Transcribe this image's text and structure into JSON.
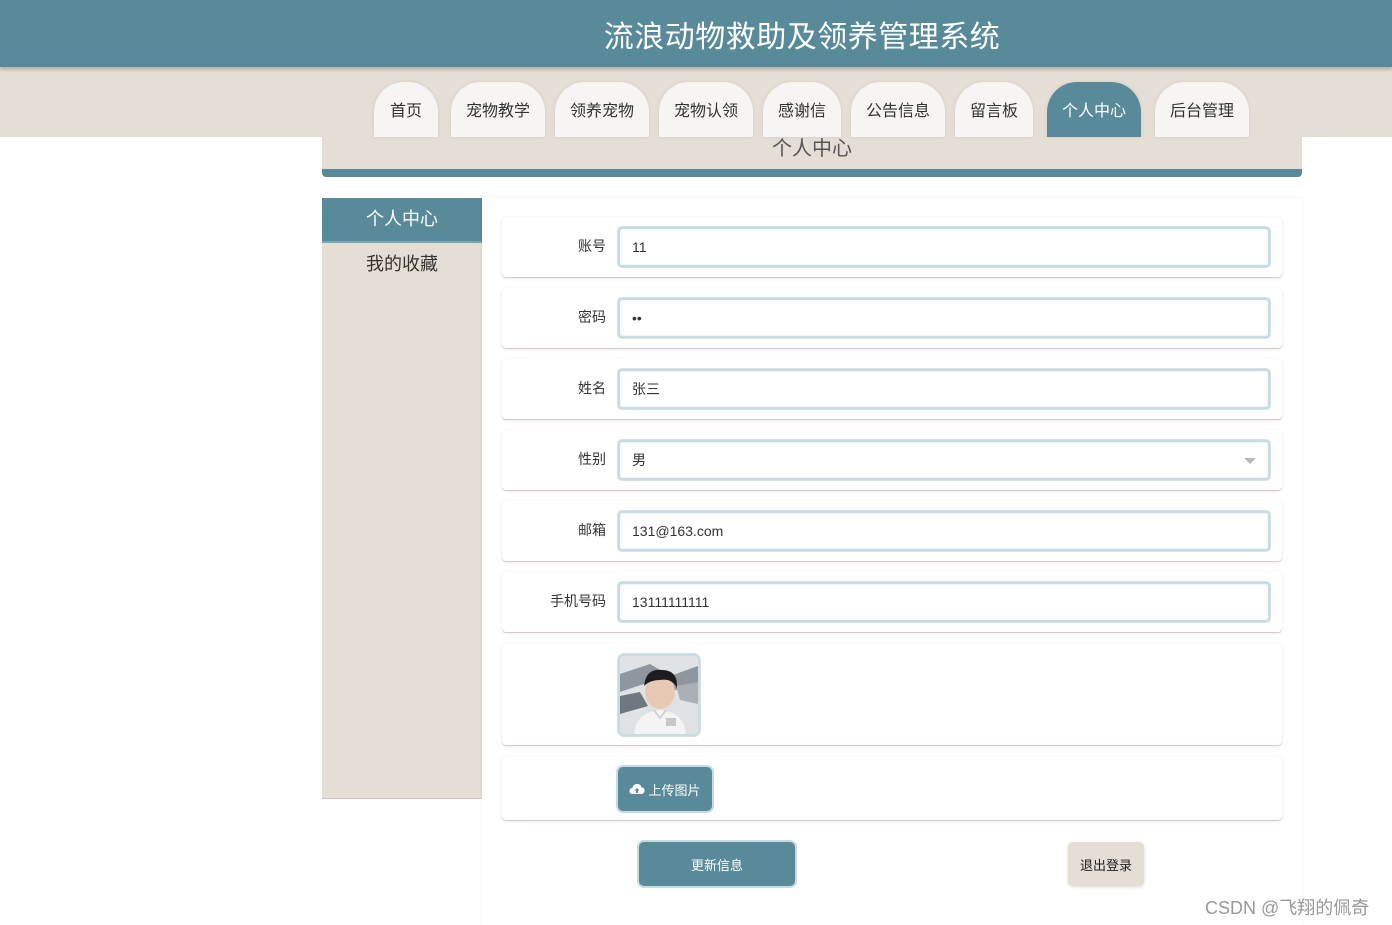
{
  "app": {
    "title": "流浪动物救助及领养管理系统"
  },
  "nav": {
    "items": [
      "首页",
      "宠物教学",
      "领养宠物",
      "宠物认领",
      "感谢信",
      "公告信息",
      "留言板",
      "个人中心",
      "后台管理"
    ],
    "active": "个人中心"
  },
  "page_header": {
    "title": "个人中心"
  },
  "sidebar": {
    "items": [
      "个人中心",
      "我的收藏"
    ],
    "active": "个人中心"
  },
  "form": {
    "account": {
      "label": "账号",
      "value": "11"
    },
    "password": {
      "label": "密码",
      "value": "••"
    },
    "name": {
      "label": "姓名",
      "value": "张三"
    },
    "gender": {
      "label": "性别",
      "value": "男"
    },
    "email": {
      "label": "邮箱",
      "value": "131@163.com"
    },
    "phone": {
      "label": "手机号码",
      "value": "13111111111"
    },
    "upload_label": "上传图片"
  },
  "actions": {
    "update": "更新信息",
    "logout": "退出登录"
  },
  "watermark": "CSDN @飞翔的佩奇",
  "colors": {
    "primary": "#588a99",
    "beige": "#e5ded4",
    "nav_tab": "#f6f5f3"
  },
  "icons": {
    "upload": "cloud-upload-icon",
    "select": "chevron-down-icon"
  }
}
